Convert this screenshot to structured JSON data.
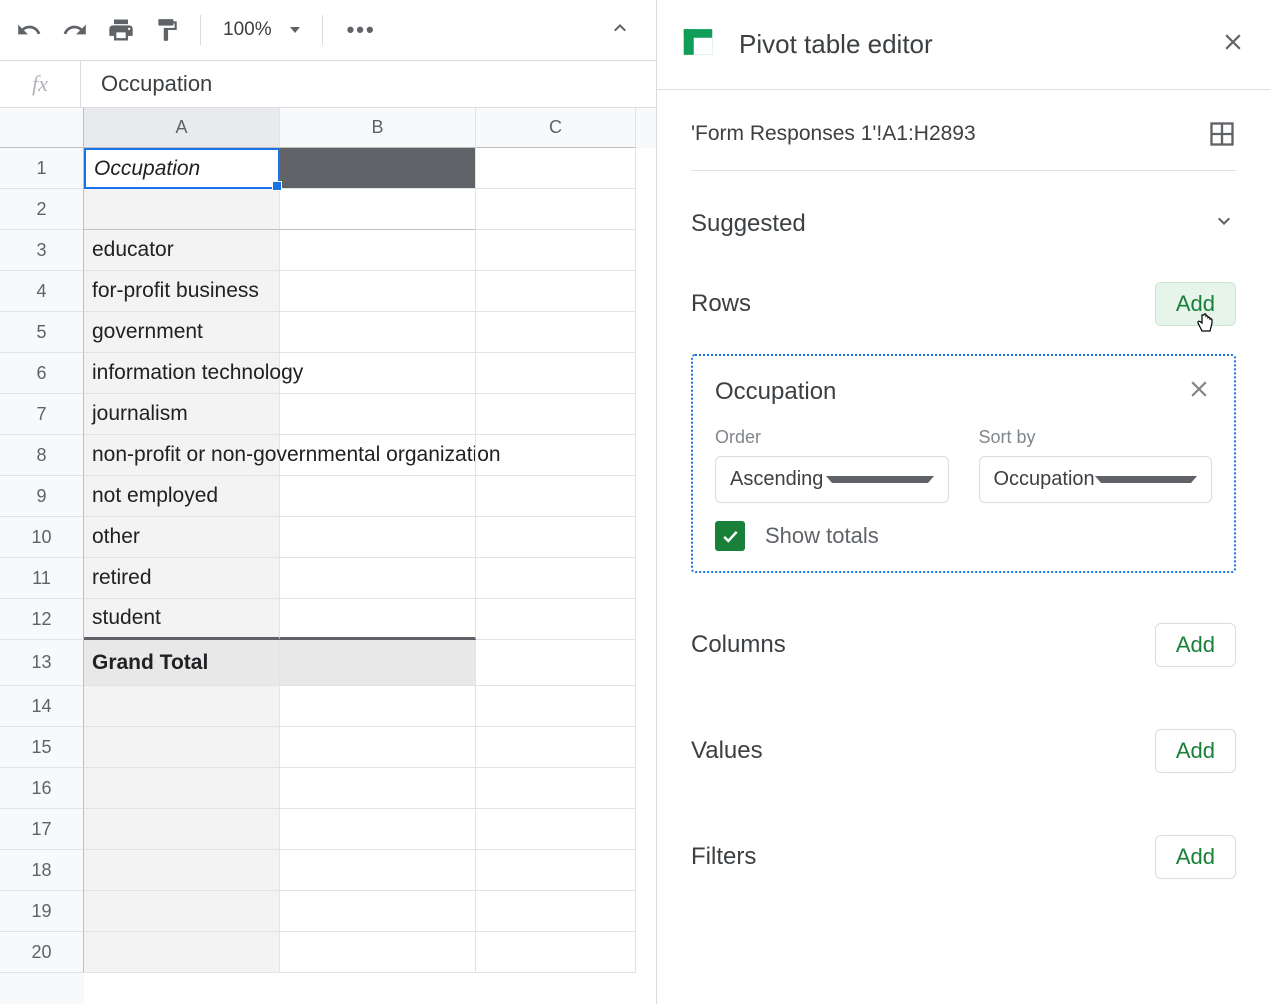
{
  "toolbar": {
    "zoom": "100%"
  },
  "formula_bar": {
    "value": "Occupation"
  },
  "columns": [
    "A",
    "B",
    "C"
  ],
  "rows": {
    "count": 20,
    "cells": {
      "1": "Occupation",
      "3": "educator",
      "4": "for-profit business",
      "5": "government",
      "6": "information technology",
      "7": "journalism",
      "8": "non-profit or non-governmental organization",
      "9": "not employed",
      "10": "other",
      "11": "retired",
      "12": "student",
      "13": "Grand Total"
    }
  },
  "editor": {
    "title": "Pivot table editor",
    "range": "'Form Responses 1'!A1:H2893",
    "suggested": "Suggested",
    "sections": {
      "rows": "Rows",
      "columns": "Columns",
      "values": "Values",
      "filters": "Filters",
      "add": "Add"
    },
    "field": {
      "name": "Occupation",
      "order_label": "Order",
      "order_value": "Ascending",
      "sortby_label": "Sort by",
      "sortby_value": "Occupation",
      "show_totals": "Show totals"
    }
  }
}
